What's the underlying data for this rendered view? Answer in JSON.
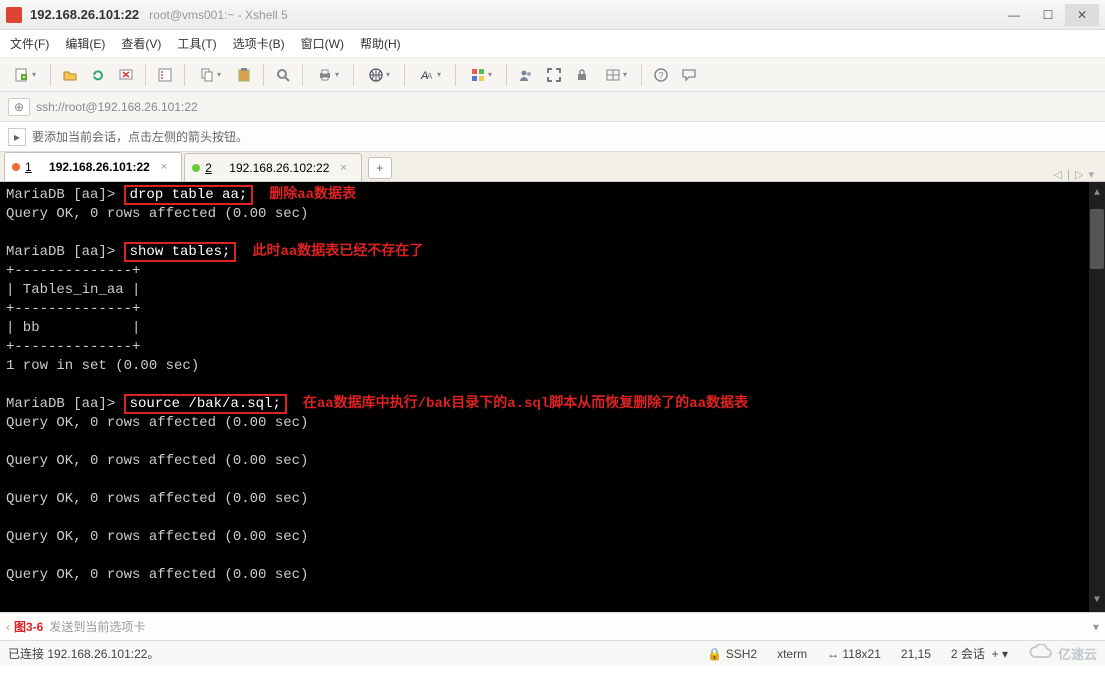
{
  "titlebar": {
    "ip": "192.168.26.101:22",
    "subtitle": "root@vms001:~ - Xshell 5"
  },
  "menu": {
    "file": "文件(F)",
    "edit": "编辑(E)",
    "view": "查看(V)",
    "tools": "工具(T)",
    "tabs": "选项卡(B)",
    "window": "窗口(W)",
    "help": "帮助(H)"
  },
  "address": {
    "scheme_label": "⊕",
    "url": "ssh://root@192.168.26.101:22"
  },
  "hint": {
    "text": "要添加当前会话，点击左侧的箭头按钮。"
  },
  "tabs": {
    "t1": {
      "num": "1",
      "label": "192.168.26.101:22"
    },
    "t2": {
      "num": "2",
      "label": "192.168.26.102:22"
    },
    "add": "+",
    "nav": "◁ |  ▷ ▾"
  },
  "terminal": {
    "prompt": "MariaDB [aa]>",
    "cmd1": "drop table aa;",
    "ann1": "删除aa数据表",
    "resp1": "Query OK, 0 rows affected (0.00 sec)",
    "cmd2": "show tables;",
    "ann2": "此时aa数据表已经不存在了",
    "tbl_border": "+--------------+",
    "tbl_head": "| Tables_in_aa |",
    "tbl_row": "| bb           |",
    "rows_in_set": "1 row in set (0.00 sec)",
    "cmd3": "source /bak/a.sql;",
    "ann3": "在aa数据库中执行/bak目录下的a.sql脚本从而恢复删除了的aa数据表",
    "qok": "Query OK, 0 rows affected (0.00 sec)"
  },
  "sendbar": {
    "figure": "图3-6",
    "text": "发送到当前选项卡"
  },
  "status": {
    "conn": "已连接 192.168.26.101:22。",
    "proto": "SSH2",
    "term": "xterm",
    "size": "118x21",
    "cursor": "21,15",
    "sessions": "2 会话",
    "brand": "亿速云"
  },
  "icons": {
    "lock": "🔒"
  }
}
